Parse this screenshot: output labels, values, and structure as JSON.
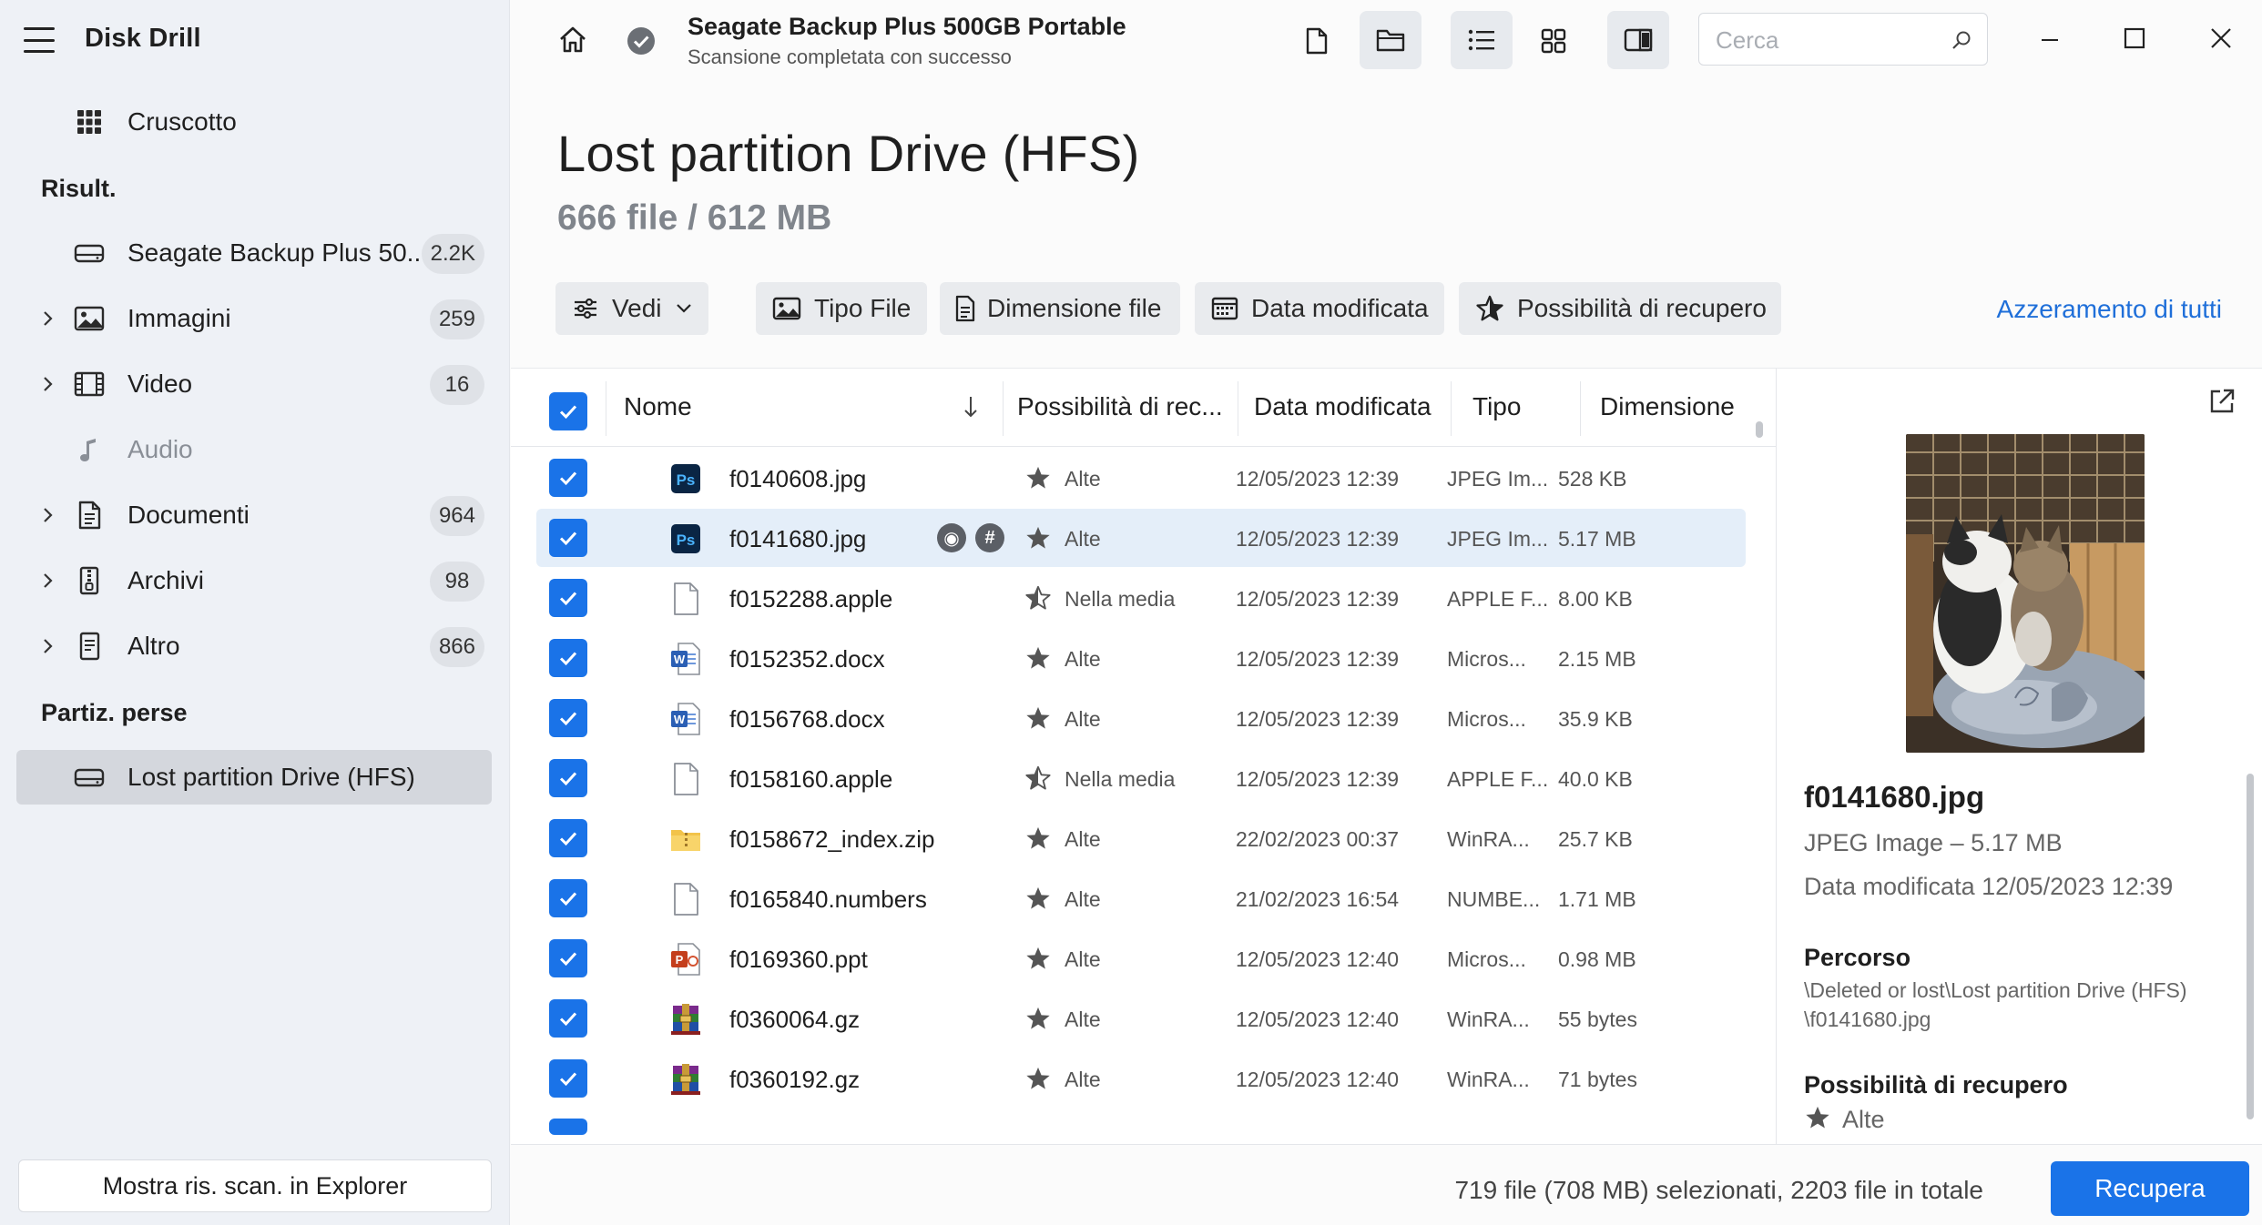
{
  "app": {
    "title": "Disk Drill"
  },
  "sidebar": {
    "dashboard": {
      "label": "Cruscotto",
      "icon": "grid-icon"
    },
    "results_heading": "Risult.",
    "results": [
      {
        "label": "Seagate Backup Plus 50...",
        "badge": "2.2K",
        "icon": "drive-icon",
        "expandable": false
      },
      {
        "label": "Immagini",
        "badge": "259",
        "icon": "image-icon",
        "expandable": true
      },
      {
        "label": "Video",
        "badge": "16",
        "icon": "video-icon",
        "expandable": true
      },
      {
        "label": "Audio",
        "badge": "",
        "icon": "music-icon",
        "expandable": false
      },
      {
        "label": "Documenti",
        "badge": "964",
        "icon": "document-icon",
        "expandable": true
      },
      {
        "label": "Archivi",
        "badge": "98",
        "icon": "archive-icon",
        "expandable": true
      },
      {
        "label": "Altro",
        "badge": "866",
        "icon": "other-file-icon",
        "expandable": true
      }
    ],
    "lost_heading": "Partiz. perse",
    "lost_partition": {
      "label": "Lost partition Drive (HFS)",
      "icon": "drive-icon"
    },
    "explorer_button": "Mostra ris. scan. in Explorer"
  },
  "topbar": {
    "drive_name": "Seagate Backup Plus 500GB Portable",
    "scan_status": "Scansione completata con successo",
    "search_placeholder": "Cerca"
  },
  "page": {
    "title": "Lost partition Drive (HFS)",
    "subtitle": "666 file / 612 MB"
  },
  "filters": {
    "view": "Vedi",
    "file_type": "Tipo File",
    "file_size": "Dimensione file",
    "date_modified": "Data modificata",
    "recovery_chance": "Possibilità di recupero",
    "reset_all": "Azzeramento di tutti"
  },
  "table": {
    "columns": {
      "name": "Nome",
      "recovery": "Possibilità di rec...",
      "date": "Data modificata",
      "type": "Tipo",
      "size": "Dimensione"
    },
    "rows": [
      {
        "name": "f0140608.jpg",
        "icon": "photoshop-icon",
        "recovery": "Alte",
        "rating": "high",
        "date": "12/05/2023 12:39",
        "type": "JPEG Im...",
        "size": "528 KB"
      },
      {
        "name": "f0141680.jpg",
        "icon": "photoshop-icon",
        "recovery": "Alte",
        "rating": "high",
        "date": "12/05/2023 12:39",
        "type": "JPEG Im...",
        "size": "5.17 MB",
        "highlight": true
      },
      {
        "name": "f0152288.apple",
        "icon": "blank-file-icon",
        "recovery": "Nella media",
        "rating": "average",
        "date": "12/05/2023 12:39",
        "type": "APPLE F...",
        "size": "8.00 KB"
      },
      {
        "name": "f0152352.docx",
        "icon": "word-icon",
        "recovery": "Alte",
        "rating": "high",
        "date": "12/05/2023 12:39",
        "type": "Micros...",
        "size": "2.15 MB"
      },
      {
        "name": "f0156768.docx",
        "icon": "word-icon",
        "recovery": "Alte",
        "rating": "high",
        "date": "12/05/2023 12:39",
        "type": "Micros...",
        "size": "35.9 KB"
      },
      {
        "name": "f0158160.apple",
        "icon": "blank-file-icon",
        "recovery": "Nella media",
        "rating": "average",
        "date": "12/05/2023 12:39",
        "type": "APPLE F...",
        "size": "40.0 KB"
      },
      {
        "name": "f0158672_index.zip",
        "icon": "zip-folder-icon",
        "recovery": "Alte",
        "rating": "high",
        "date": "22/02/2023 00:37",
        "type": "WinRA...",
        "size": "25.7 KB"
      },
      {
        "name": "f0165840.numbers",
        "icon": "blank-file-icon",
        "recovery": "Alte",
        "rating": "high",
        "date": "21/02/2023 16:54",
        "type": "NUMBE...",
        "size": "1.71 MB"
      },
      {
        "name": "f0169360.ppt",
        "icon": "powerpoint-icon",
        "recovery": "Alte",
        "rating": "high",
        "date": "12/05/2023 12:40",
        "type": "Micros...",
        "size": "0.98 MB"
      },
      {
        "name": "f0360064.gz",
        "icon": "winrar-icon",
        "recovery": "Alte",
        "rating": "high",
        "date": "12/05/2023 12:40",
        "type": "WinRA...",
        "size": "55 bytes"
      },
      {
        "name": "f0360192.gz",
        "icon": "winrar-icon",
        "recovery": "Alte",
        "rating": "high",
        "date": "12/05/2023 12:40",
        "type": "WinRA...",
        "size": "71 bytes"
      }
    ]
  },
  "preview": {
    "file_name": "f0141680.jpg",
    "file_info": "JPEG Image – 5.17 MB",
    "modified": "Data modificata 12/05/2023 12:39",
    "path_heading": "Percorso",
    "path_line1": "\\Deleted or lost\\Lost partition Drive (HFS)",
    "path_line2": "\\f0141680.jpg",
    "recovery_heading": "Possibilità di recupero",
    "recovery_value": "Alte"
  },
  "footer": {
    "status": "719 file (708 MB) selezionati, 2203 file in totale",
    "recover_button": "Recupera"
  },
  "colors": {
    "accent": "#1a73e8",
    "selected_row": "#e4eef9",
    "sidebar_bg": "#eef1f6"
  }
}
